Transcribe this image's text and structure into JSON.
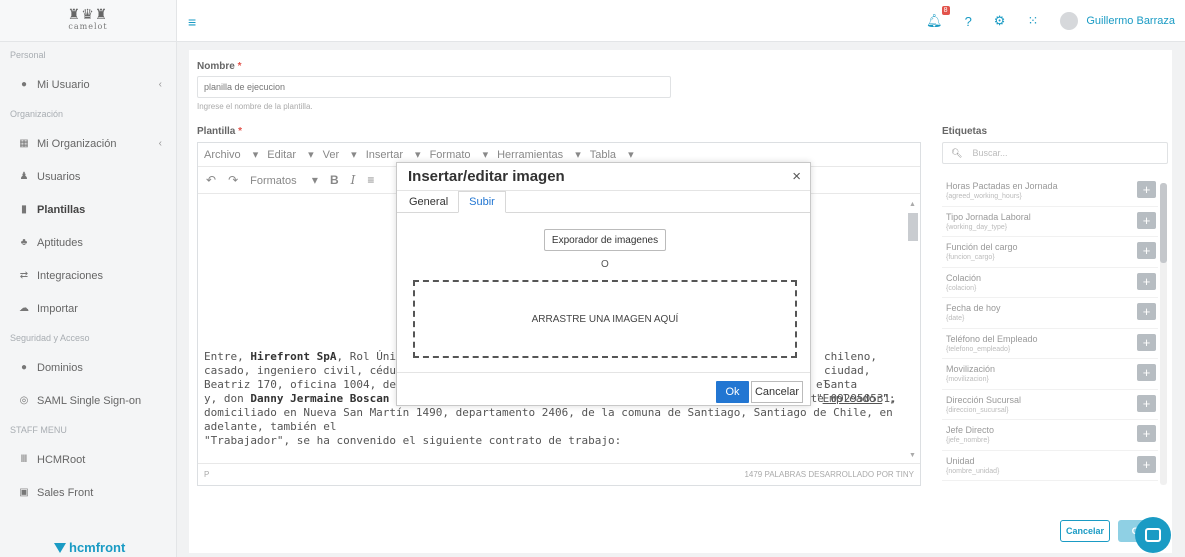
{
  "app": {
    "logo_text": "camelot",
    "brand_text": "hcmfront",
    "user_name": "Guillermo Barraza",
    "notification_count": "8"
  },
  "sidebar": {
    "sections": [
      {
        "label": "Personal",
        "items": [
          {
            "label": "Mi Usuario",
            "icon": "user-icon",
            "chevron": true
          }
        ]
      },
      {
        "label": "Organización",
        "items": [
          {
            "label": "Mi Organización",
            "icon": "building-icon",
            "chevron": true
          },
          {
            "label": "Usuarios",
            "icon": "users-icon"
          },
          {
            "label": "Plantillas",
            "icon": "file-icon",
            "active": true
          },
          {
            "label": "Aptitudes",
            "icon": "sitemap-icon"
          },
          {
            "label": "Integraciones",
            "icon": "exchange-icon"
          },
          {
            "label": "Importar",
            "icon": "cloud-icon"
          }
        ]
      },
      {
        "label": "Seguridad y Acceso",
        "items": [
          {
            "label": "Dominios",
            "icon": "circle-icon"
          },
          {
            "label": "SAML Single Sign-on",
            "icon": "shield-icon"
          }
        ]
      },
      {
        "label": "STAFF MENU",
        "items": [
          {
            "label": "HCMRoot",
            "icon": "root-icon"
          },
          {
            "label": "Sales Front",
            "icon": "id-card-icon"
          }
        ]
      }
    ]
  },
  "form": {
    "name_label": "Nombre",
    "name_value": "planilla de ejecucion",
    "name_help": "Ingrese el nombre de la plantilla.",
    "template_label": "Plantilla",
    "tags_label": "Etiquetas",
    "required_mark": "*"
  },
  "editor": {
    "menus": [
      "Archivo",
      "Editar",
      "Ver",
      "Insertar",
      "Formato",
      "Herramientas",
      "Tabla"
    ],
    "formats_label": "Formatos",
    "status_left": "P",
    "status_right": "1479 PALABRAS DESARROLLADO POR TINY",
    "content": {
      "l1a": "Entre, ",
      "l1b": "Hirefront SpA",
      "l1c": ", Rol Único Trib",
      "l1d": "chileno,",
      "l2a": "casado, ingeniero civil, cédula nacion",
      "l2b": "ciudad, Santa",
      "l3a": "Beatriz 170, oficina 1004, de la comu",
      "l3b": "el \"",
      "l3c": "Empleador",
      "l3d": "\";",
      "l4a": "y, don ",
      "l4b": "Danny Jermaine Boscan Ov",
      "l4c": "rte 092950531,",
      "l5": "domiciliado en Nueva San Martín 1490, departamento 2406, de la comuna de Santiago, Santiago de Chile, en adelante, también el",
      "l6": "\"Trabajador\", se ha convenido el siguiente contrato de trabajo:"
    }
  },
  "tags": {
    "search_placeholder": "Buscar...",
    "items": [
      {
        "name": "Horas Pactadas en Jornada",
        "key": "{agreed_working_hours}"
      },
      {
        "name": "Tipo Jornada Laboral",
        "key": "{working_day_type}"
      },
      {
        "name": "Función del cargo",
        "key": "{funcion_cargo}"
      },
      {
        "name": "Colación",
        "key": "{colacion}"
      },
      {
        "name": "Fecha de hoy",
        "key": "{date}"
      },
      {
        "name": "Teléfono del Empleado",
        "key": "{telefono_empleado}"
      },
      {
        "name": "Movilización",
        "key": "{movilizacion}"
      },
      {
        "name": "Dirección Sucursal",
        "key": "{direccion_sucursal}"
      },
      {
        "name": "Jefe Directo",
        "key": "{jefe_nombre}"
      },
      {
        "name": "Unidad",
        "key": "{nombre_unidad}"
      }
    ],
    "plus_label": "+"
  },
  "actions": {
    "cancel_label": "Cancelar",
    "save_label": "Gu"
  },
  "dialog": {
    "title": "Insertar/editar imagen",
    "close_symbol": "×",
    "tabs": [
      "General",
      "Subir"
    ],
    "explorer_label": "Exporador de imagenes",
    "or_label": "O",
    "dropzone_label": "ARRASTRE UNA IMAGEN AQUÍ",
    "ok_label": "Ok",
    "cancel_label": "Cancelar"
  },
  "colors": {
    "accent": "#1a9bc4",
    "dialog_primary": "#2276d2",
    "required": "#e2534b"
  }
}
